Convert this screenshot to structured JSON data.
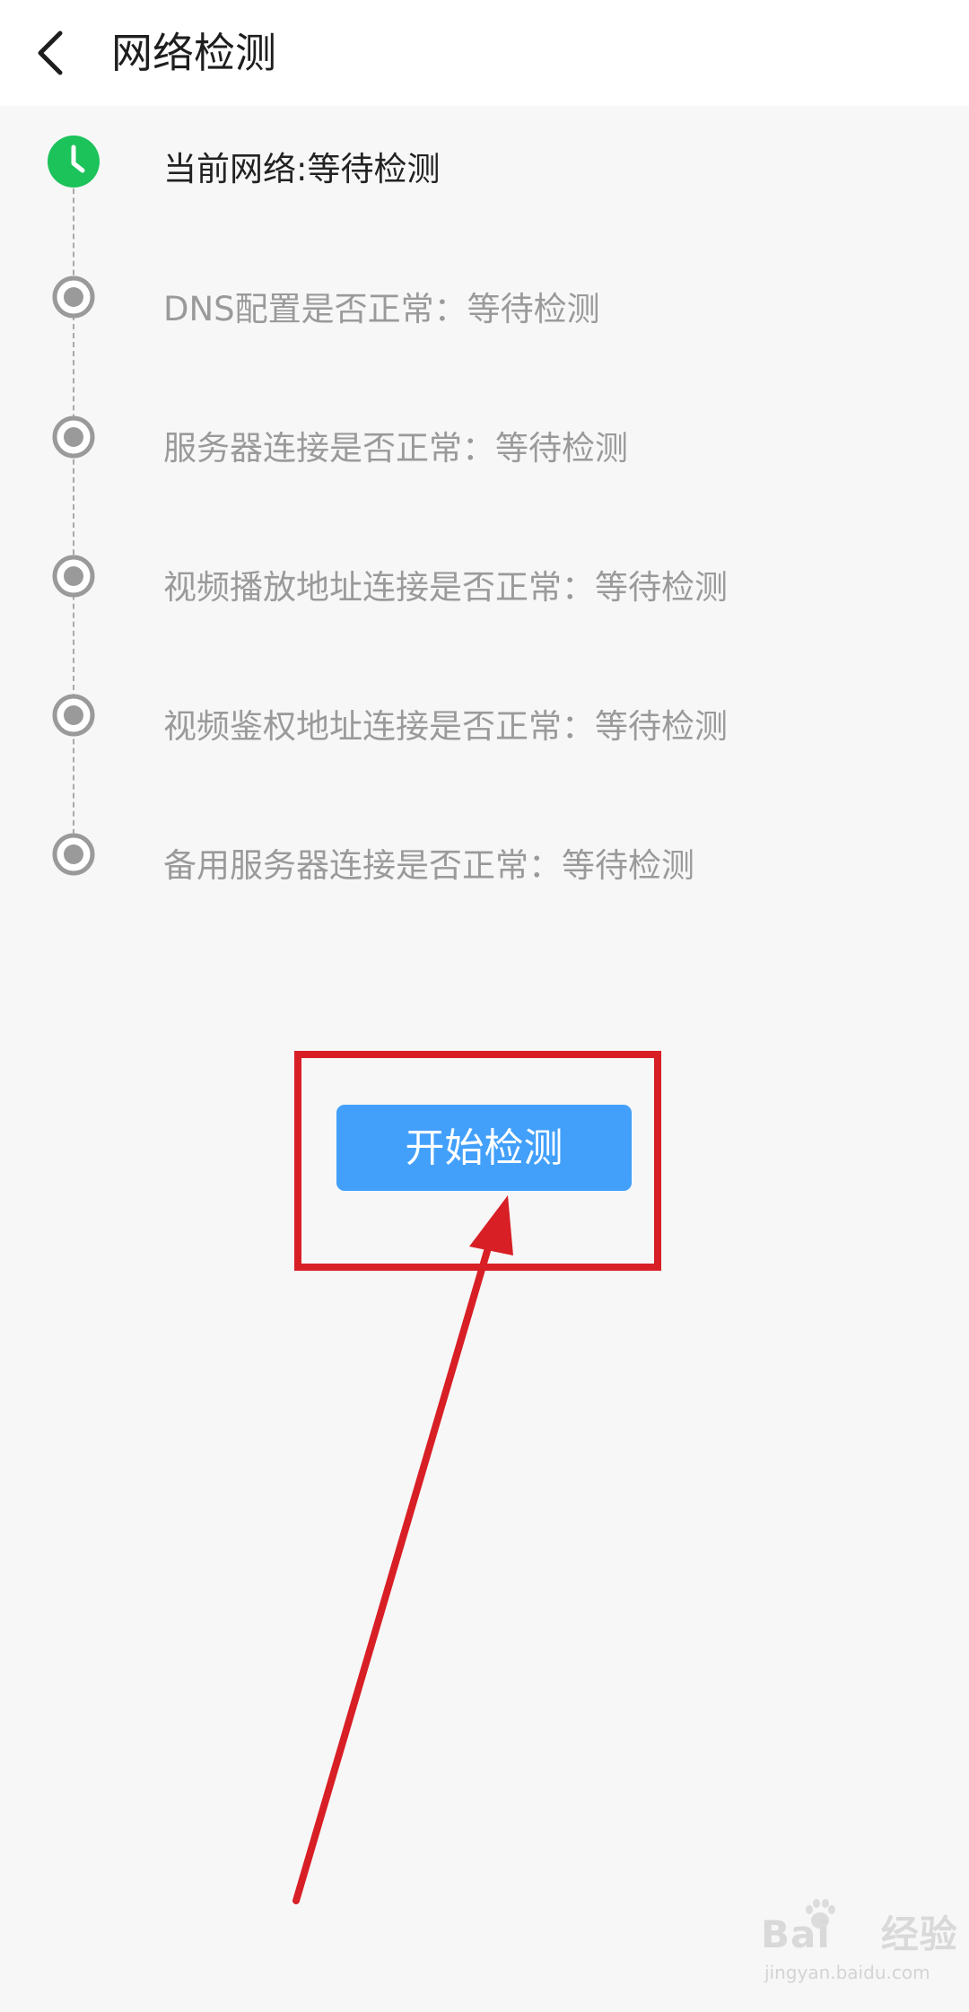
{
  "header": {
    "title": "网络检测"
  },
  "steps": [
    {
      "label": "当前网络:等待检测",
      "state": "active"
    },
    {
      "label": "DNS配置是否正常：等待检测",
      "state": "pending"
    },
    {
      "label": "服务器连接是否正常：等待检测",
      "state": "pending"
    },
    {
      "label": "视频播放地址连接是否正常：等待检测",
      "state": "pending"
    },
    {
      "label": "视频鉴权地址连接是否正常：等待检测",
      "state": "pending"
    },
    {
      "label": "备用服务器连接是否正常：等待检测",
      "state": "pending"
    }
  ],
  "start_button": {
    "label": "开始检测"
  },
  "watermark": {
    "brand": "Bai",
    "brand_tail": "经验",
    "url": "jingyan.baidu.com"
  },
  "colors": {
    "accent": "#42a0fb",
    "active_step": "#1cc35a",
    "pending_step": "#9a9a9a",
    "annotation": "#d81f26"
  },
  "icons": {
    "back": "chevron-left-icon",
    "active_step": "clock-icon",
    "pending_step": "radio-dot-icon"
  }
}
